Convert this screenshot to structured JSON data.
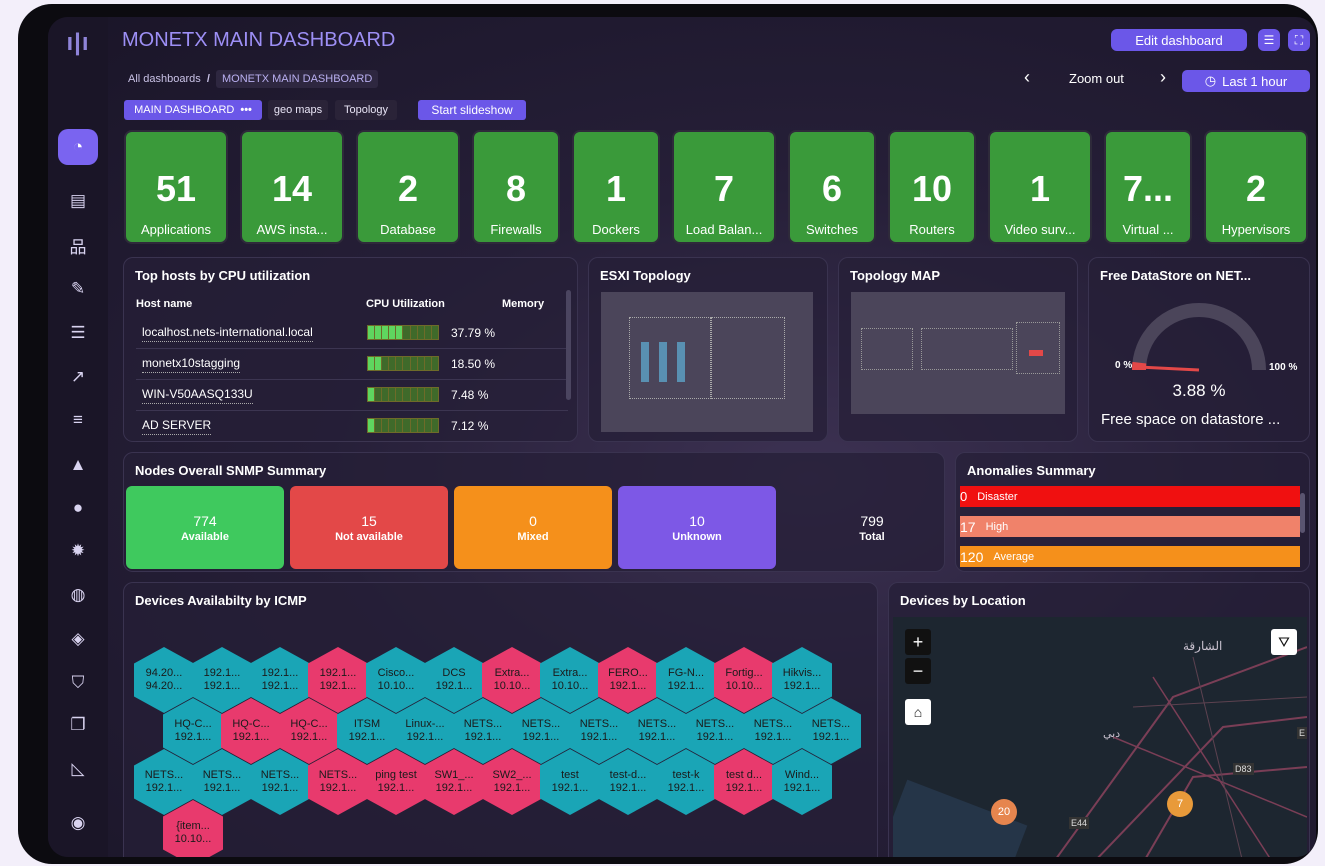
{
  "sidebar": {
    "logo": "ı|ı",
    "icons": [
      {
        "name": "dashboard-icon",
        "glyph": "◔"
      },
      {
        "name": "report-icon",
        "glyph": "▤"
      },
      {
        "name": "network-icon",
        "glyph": "品"
      },
      {
        "name": "wrench-icon",
        "glyph": "✎"
      },
      {
        "name": "table-icon",
        "glyph": "☰"
      },
      {
        "name": "chart-icon",
        "glyph": "↗"
      },
      {
        "name": "database-icon",
        "glyph": "≡"
      },
      {
        "name": "alert-icon",
        "glyph": "▲"
      },
      {
        "name": "user-icon",
        "glyph": "●"
      },
      {
        "name": "settings-icon",
        "glyph": "✹"
      },
      {
        "name": "globe-icon",
        "glyph": "◍"
      },
      {
        "name": "cube-icon",
        "glyph": "◈"
      },
      {
        "name": "shield-icon",
        "glyph": "⛉"
      },
      {
        "name": "files-icon",
        "glyph": "❐"
      },
      {
        "name": "area-chart-icon",
        "glyph": "◺"
      },
      {
        "name": "account-icon",
        "glyph": "◉"
      }
    ]
  },
  "header": {
    "title": "MONETX MAIN DASHBOARD",
    "edit_label": "Edit dashboard",
    "menu_glyph": "☰",
    "fullscreen_glyph": "⛶"
  },
  "breadcrumb": {
    "root": "All dashboards",
    "sep": "/",
    "current": "MONETX MAIN DASHBOARD"
  },
  "zoom": {
    "prev": "‹",
    "label": "Zoom out",
    "next": "›",
    "range_label": "Last 1 hour",
    "clock_glyph": "◷"
  },
  "tabs": {
    "main": "MAIN DASHBOARD",
    "more": "•••",
    "geo": "geo maps",
    "topology": "Topology",
    "slideshow": "Start slideshow"
  },
  "stats": [
    {
      "value": "51",
      "label": "Applications"
    },
    {
      "value": "14",
      "label": "AWS insta..."
    },
    {
      "value": "2",
      "label": "Database"
    },
    {
      "value": "8",
      "label": "Firewalls"
    },
    {
      "value": "1",
      "label": "Dockers"
    },
    {
      "value": "7",
      "label": "Load Balan..."
    },
    {
      "value": "6",
      "label": "Switches"
    },
    {
      "value": "10",
      "label": "Routers"
    },
    {
      "value": "1",
      "label": "Video surv..."
    },
    {
      "value": "7...",
      "label": "Virtual ..."
    },
    {
      "value": "2",
      "label": "Hypervisors"
    }
  ],
  "cpu": {
    "title": "Top hosts by CPU utilization",
    "col_host": "Host name",
    "col_cpu": "CPU Utilization",
    "col_mem": "Memory",
    "rows": [
      {
        "host": "localhost.nets-international.local",
        "pct": "37.79 %",
        "level": 0.3779
      },
      {
        "host": "monetx10stagging",
        "pct": "18.50 %",
        "level": 0.185
      },
      {
        "host": "WIN-V50AASQ133U",
        "pct": "7.48 %",
        "level": 0.0748
      },
      {
        "host": "AD SERVER",
        "pct": "7.12 %",
        "level": 0.0712
      }
    ]
  },
  "esxi": {
    "title": "ESXI Topology"
  },
  "topomap": {
    "title": "Topology MAP"
  },
  "datastore": {
    "title": "Free DataStore on NET...",
    "min": "0 %",
    "max": "100 %",
    "value": "3.88 %",
    "level": 0.0388,
    "caption": "Free space on datastore ..."
  },
  "snmp": {
    "title": "Nodes Overall SNMP Summary",
    "items": [
      {
        "n": "774",
        "l": "Available",
        "color": "#3fc95e"
      },
      {
        "n": "15",
        "l": "Not available",
        "color": "#e34848"
      },
      {
        "n": "0",
        "l": "Mixed",
        "color": "#f5901b"
      },
      {
        "n": "10",
        "l": "Unknown",
        "color": "#7d58e6"
      }
    ],
    "total_n": "799",
    "total_l": "Total"
  },
  "anomalies": {
    "title": "Anomalies Summary",
    "items": [
      {
        "n": "0",
        "l": "Disaster",
        "color": "#f01010"
      },
      {
        "n": "17",
        "l": "High",
        "color": "#f0826a"
      },
      {
        "n": "120",
        "l": "Average",
        "color": "#f5901b"
      }
    ]
  },
  "icmp": {
    "title": "Devices Availabilty by ICMP",
    "rows": [
      [
        [
          "94.20...",
          "94.20...",
          "t"
        ],
        [
          "192.1...",
          "192.1...",
          "t"
        ],
        [
          "192.1...",
          "192.1...",
          "t"
        ],
        [
          "192.1...",
          "192.1...",
          "p"
        ],
        [
          "Cisco...",
          "10.10...",
          "t"
        ],
        [
          "DCS",
          "192.1...",
          "t"
        ],
        [
          "Extra...",
          "10.10...",
          "p"
        ],
        [
          "Extra...",
          "10.10...",
          "t"
        ],
        [
          "FERO...",
          "192.1...",
          "p"
        ],
        [
          "FG-N...",
          "192.1...",
          "t"
        ],
        [
          "Fortig...",
          "10.10...",
          "p"
        ],
        [
          "Hikvis...",
          "192.1...",
          "t"
        ]
      ],
      [
        [
          "HQ-C...",
          "192.1...",
          "t"
        ],
        [
          "HQ-C...",
          "192.1...",
          "p"
        ],
        [
          "HQ-C...",
          "192.1...",
          "p"
        ],
        [
          "ITSM",
          "192.1...",
          "t"
        ],
        [
          "Linux-...",
          "192.1...",
          "t"
        ],
        [
          "NETS...",
          "192.1...",
          "t"
        ],
        [
          "NETS...",
          "192.1...",
          "t"
        ],
        [
          "NETS...",
          "192.1...",
          "t"
        ],
        [
          "NETS...",
          "192.1...",
          "t"
        ],
        [
          "NETS...",
          "192.1...",
          "t"
        ],
        [
          "NETS...",
          "192.1...",
          "t"
        ],
        [
          "NETS...",
          "192.1...",
          "t"
        ]
      ],
      [
        [
          "NETS...",
          "192.1...",
          "t"
        ],
        [
          "NETS...",
          "192.1...",
          "t"
        ],
        [
          "NETS...",
          "192.1...",
          "t"
        ],
        [
          "NETS...",
          "192.1...",
          "p"
        ],
        [
          "ping test",
          "192.1...",
          "p"
        ],
        [
          "SW1_...",
          "192.1...",
          "p"
        ],
        [
          "SW2_...",
          "192.1...",
          "p"
        ],
        [
          "test",
          "192.1...",
          "t"
        ],
        [
          "test-d...",
          "192.1...",
          "t"
        ],
        [
          "test-k",
          "192.1...",
          "t"
        ],
        [
          "test d...",
          "192.1...",
          "p"
        ],
        [
          "Wind...",
          "192.1...",
          "t"
        ]
      ],
      [
        [
          "{item...",
          "10.10...",
          "p"
        ]
      ]
    ]
  },
  "location": {
    "title": "Devices by Location",
    "zoom_in": "+",
    "zoom_out": "−",
    "home_glyph": "⌂",
    "filter_glyph": "⛛",
    "clusters": [
      "20",
      "7"
    ],
    "map_labels": [
      "الشارقة",
      "دبي",
      "D83",
      "E44",
      "E"
    ]
  }
}
